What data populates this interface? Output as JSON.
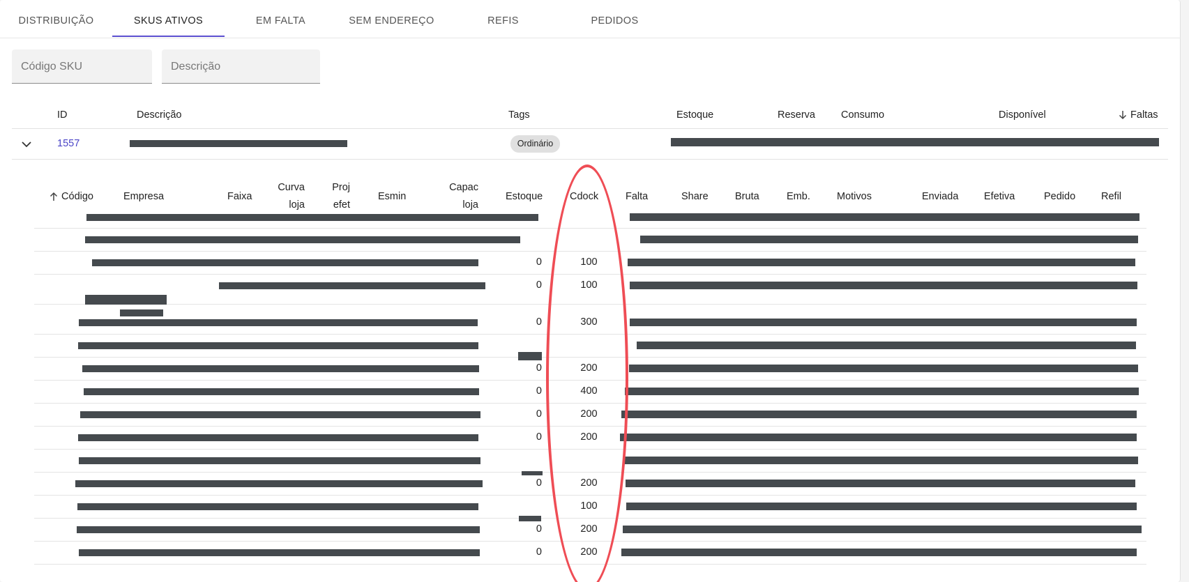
{
  "tabs": [
    {
      "label": "DISTRIBUIÇÃO",
      "active": false
    },
    {
      "label": "SKUS ATIVOS",
      "active": true
    },
    {
      "label": "EM FALTA",
      "active": false
    },
    {
      "label": "SEM ENDEREÇO",
      "active": false
    },
    {
      "label": "REFIS",
      "active": false
    },
    {
      "label": "PEDIDOS",
      "active": false
    }
  ],
  "filters": {
    "sku_placeholder": "Código SKU",
    "descricao_placeholder": "Descrição"
  },
  "main_table": {
    "headers": {
      "id": "ID",
      "descricao": "Descrição",
      "tags": "Tags",
      "estoque": "Estoque",
      "reserva": "Reserva",
      "consumo": "Consumo",
      "disponivel": "Disponível",
      "faltas": "Faltas"
    },
    "row": {
      "id": "1557",
      "tag": "Ordinário"
    }
  },
  "sub_table": {
    "headers": {
      "codigo": "Código",
      "empresa": "Empresa",
      "faixa": "Faixa",
      "curva_1": "Curva",
      "curva_2": "loja",
      "proj_1": "Proj",
      "proj_2": "efet",
      "esmin": "Esmin",
      "capac_1": "Capac",
      "capac_2": "loja",
      "estoque": "Estoque",
      "cdock": "Cdock",
      "falta": "Falta",
      "share": "Share",
      "bruta": "Bruta",
      "emb": "Emb.",
      "motivos": "Motivos",
      "enviada": "Enviada",
      "efetiva": "Efetiva",
      "pedido": "Pedido",
      "refil": "Refil"
    },
    "rows": [
      {
        "estoque": "",
        "cdock": ""
      },
      {
        "estoque": "",
        "cdock": ""
      },
      {
        "estoque": "0",
        "cdock": "100"
      },
      {
        "estoque": "0",
        "cdock": "100"
      },
      {
        "estoque": "0",
        "cdock": "300"
      },
      {
        "estoque": "",
        "cdock": ""
      },
      {
        "estoque": "0",
        "cdock": "200"
      },
      {
        "estoque": "0",
        "cdock": "400"
      },
      {
        "estoque": "0",
        "cdock": "200"
      },
      {
        "estoque": "0",
        "cdock": "200"
      },
      {
        "estoque": "",
        "cdock": ""
      },
      {
        "estoque": "0",
        "cdock": "200"
      },
      {
        "estoque": "",
        "cdock": "100"
      },
      {
        "estoque": "0",
        "cdock": "200"
      },
      {
        "estoque": "0",
        "cdock": "200"
      }
    ]
  },
  "colors": {
    "accent": "#5b4fd0",
    "link": "#4a44c7",
    "highlight_oval": "#ef4d55",
    "redaction": "#454a4e"
  }
}
